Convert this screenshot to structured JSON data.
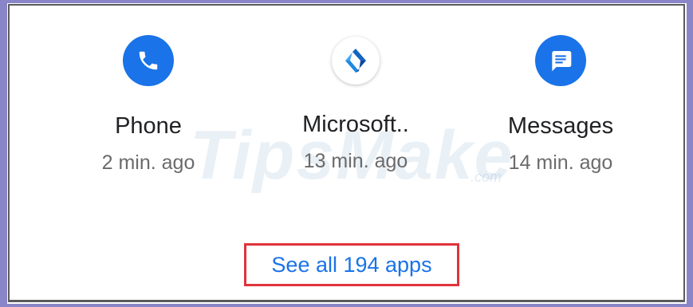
{
  "apps": [
    {
      "name": "Phone",
      "time": "2 min. ago",
      "icon": "phone-icon",
      "color": "#1a73e8"
    },
    {
      "name": "Microsoft..",
      "time": "13 min. ago",
      "icon": "microsoft-launcher-icon",
      "color": "#1e88e5"
    },
    {
      "name": "Messages",
      "time": "14 min. ago",
      "icon": "messages-icon",
      "color": "#1a73e8"
    }
  ],
  "see_all": {
    "label": "See all 194 apps",
    "highlight_color": "#e0333a"
  },
  "watermark": {
    "text": "TipsMake",
    "suffix": ".com"
  }
}
